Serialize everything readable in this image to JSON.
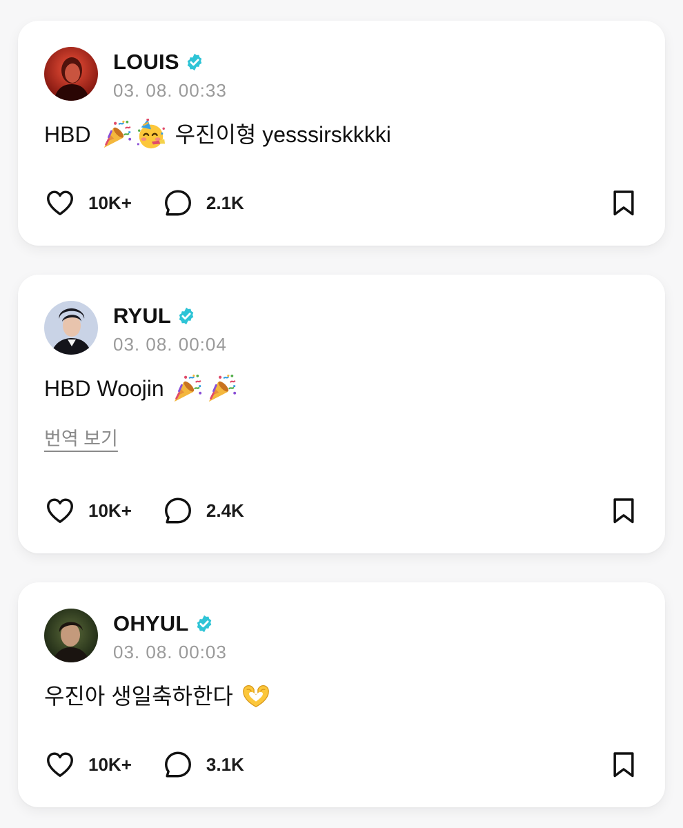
{
  "accent_color": "#2ec4d6",
  "posts": [
    {
      "author": "LOUIS",
      "verified": true,
      "timestamp": "03. 08. 00:33",
      "text_before": "HBD",
      "emojis": [
        "party-popper",
        "partying-face"
      ],
      "text_after": "우진이형 yesssirskkkki",
      "likes": "10K+",
      "comments": "2.1K"
    },
    {
      "author": "RYUL",
      "verified": true,
      "timestamp": "03. 08. 00:04",
      "text_before": "HBD Woojin",
      "emojis": [
        "party-popper",
        "party-popper"
      ],
      "translate_label": "번역 보기",
      "likes": "10K+",
      "comments": "2.4K"
    },
    {
      "author": "OHYUL",
      "verified": true,
      "timestamp": "03. 08. 00:03",
      "text_before": "우진아 생일축하한다",
      "emojis": [
        "heart-hands"
      ],
      "likes": "10K+",
      "comments": "3.1K"
    }
  ]
}
